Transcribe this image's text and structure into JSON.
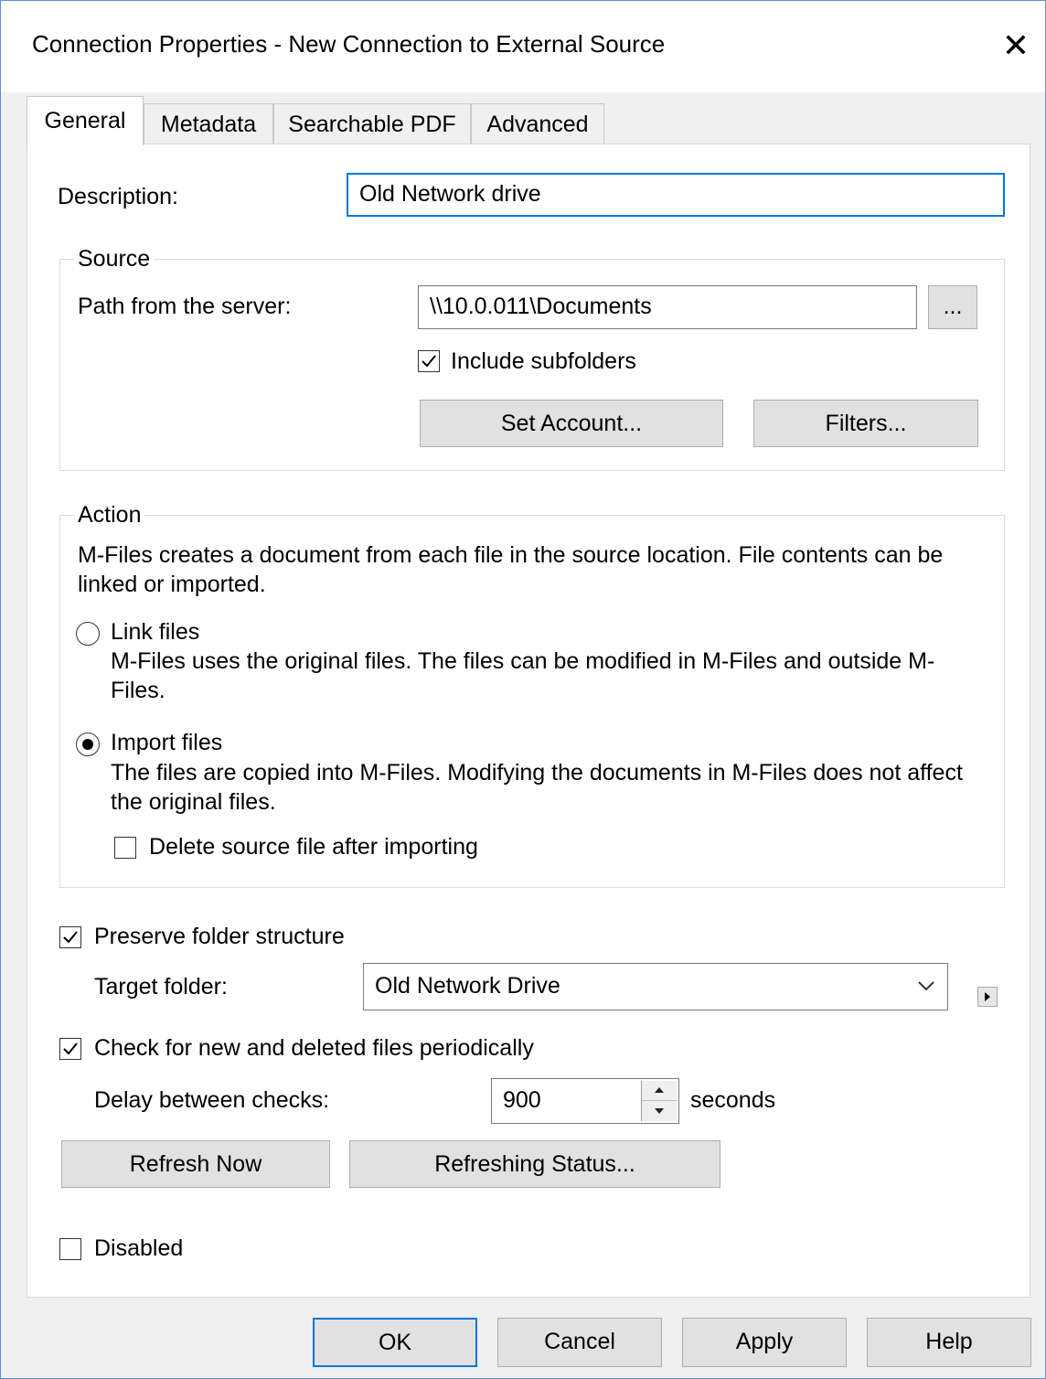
{
  "dialog": {
    "title": "Connection Properties - New Connection to External Source",
    "close_glyph": "✕"
  },
  "tabs": [
    {
      "label": "General",
      "active": true
    },
    {
      "label": "Metadata",
      "active": false
    },
    {
      "label": "Searchable PDF",
      "active": false
    },
    {
      "label": "Advanced",
      "active": false
    }
  ],
  "general": {
    "description_label": "Description:",
    "description_value": "Old Network drive",
    "source": {
      "legend": "Source",
      "path_label": "Path from the server:",
      "path_value": "\\\\10.0.011\\Documents",
      "browse_label": "...",
      "include_subfolders_label": "Include subfolders",
      "include_subfolders_checked": true,
      "set_account_label": "Set Account...",
      "filters_label": "Filters..."
    },
    "action": {
      "legend": "Action",
      "intro": "M-Files creates a document from each file in the source location. File contents can be linked or imported.",
      "link_label": "Link files",
      "link_desc": "M-Files uses the original files. The files can be modified in M-Files and outside M-Files.",
      "link_selected": false,
      "import_label": "Import files",
      "import_desc": "The files are copied into M-Files. Modifying the documents in M-Files does not affect the original files.",
      "import_selected": true,
      "delete_source_label": "Delete source file after importing",
      "delete_source_checked": false
    },
    "preserve_label": "Preserve folder structure",
    "preserve_checked": true,
    "target_folder_label": "Target folder:",
    "target_folder_value": "Old Network Drive",
    "check_periodically_label": "Check for new and deleted files periodically",
    "check_periodically_checked": true,
    "delay_label": "Delay between checks:",
    "delay_value": "900",
    "delay_unit": "seconds",
    "refresh_now_label": "Refresh Now",
    "refreshing_status_label": "Refreshing Status...",
    "disabled_label": "Disabled",
    "disabled_checked": false
  },
  "footer": {
    "ok_label": "OK",
    "cancel_label": "Cancel",
    "apply_label": "Apply",
    "help_label": "Help"
  }
}
